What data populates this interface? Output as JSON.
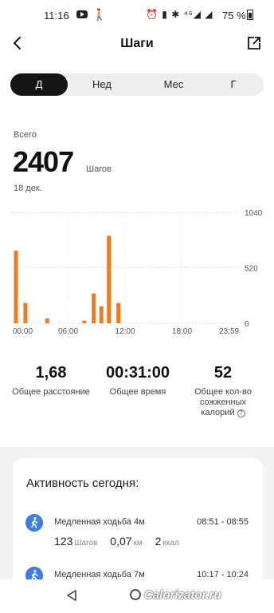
{
  "status_bar": {
    "time": "11:16",
    "icons": "⏰ ▮ ✱ ⁴⁶◢ ◢",
    "battery": "75 %"
  },
  "header": {
    "title": "Шаги",
    "back_icon": "chevron-left-icon",
    "share_icon": "share-icon"
  },
  "tabs": [
    {
      "label": "Д",
      "active": true
    },
    {
      "label": "Нед",
      "active": false
    },
    {
      "label": "Мес",
      "active": false
    },
    {
      "label": "Г",
      "active": false
    }
  ],
  "summary": {
    "label": "Всего",
    "total": "2407",
    "unit": "Шагов",
    "date": "18 дек."
  },
  "chart_data": {
    "type": "bar",
    "x_tick_labels": [
      "00:00",
      "06:00",
      "12:00",
      "18:00",
      "23:59"
    ],
    "y_tick_labels": [
      "1040",
      "520",
      "0"
    ],
    "ylim": [
      0,
      1040
    ],
    "xlim": [
      0,
      24
    ],
    "bar_color": "#f07b1f",
    "x": [
      0.5,
      1.5,
      3.8,
      7.7,
      8.7,
      9.5,
      10.3,
      11.3
    ],
    "values": [
      680,
      190,
      45,
      25,
      280,
      160,
      820,
      190
    ]
  },
  "stats": [
    {
      "value": "1,68",
      "label": "Общее расстояние"
    },
    {
      "value": "00:31:00",
      "label": "Общее время"
    },
    {
      "value": "52",
      "label_lines": [
        "Общее кол-во",
        "сожженных",
        "калорий"
      ]
    }
  ],
  "activity": {
    "title": "Активность сегодня:",
    "items": [
      {
        "name": "Медленная ходьба 4м",
        "range": "08:51 - 08:55",
        "steps": "123",
        "steps_unit": "Шагов",
        "distance": "0,07",
        "distance_unit": "км",
        "kcal": "2",
        "kcal_unit": "ккал"
      },
      {
        "name": "Медленная ходьба 7м",
        "range": "10:17 - 10:24"
      }
    ]
  },
  "watermark": "Calorizator.ru"
}
